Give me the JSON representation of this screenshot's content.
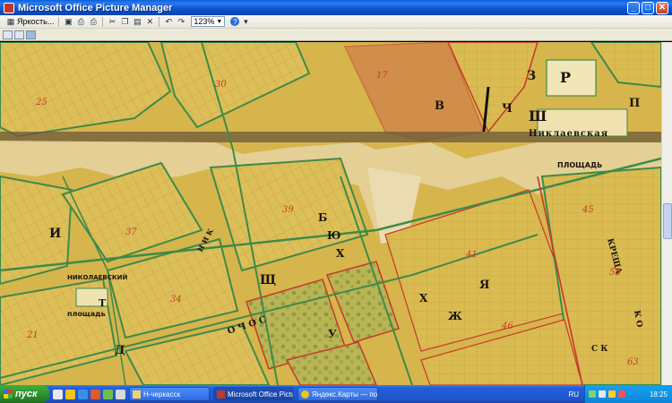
{
  "window": {
    "title": "Microsoft Office Picture Manager",
    "minimize_glyph": "_",
    "maximize_glyph": "□",
    "close_glyph": "✕"
  },
  "toolbar": {
    "edit_pictures_label": "Яркость...",
    "zoom_value": "123%",
    "help_glyph": "?"
  },
  "map": {
    "labels": {
      "nikolaevskaya": "Никлаевская",
      "ploshchad_left": "площадь",
      "ploshchad_right": "ПЛОЩАДЬ",
      "nikolaevsky": "НИКОЛАЕВСКИЙ",
      "letter_z": "З",
      "letter_r": "Р",
      "letter_v": "В",
      "letter_ch": "Ч",
      "letter_sh": "Ш",
      "letter_b": "Б",
      "letter_yu": "Ю",
      "letter_kh": "Х",
      "letter_shch": "Щ",
      "letter_i": "И",
      "letter_ya": "Я",
      "letter_kh2": "Х",
      "letter_zh": "Ж",
      "letter_t": "Т",
      "letter_d": "Д",
      "letter_o": "О",
      "letter_e": "Е",
      "letter_s": "С",
      "letter_u": "У",
      "letter_p": "П",
      "street_left": "Н И К",
      "street_right": "КРЕЩА",
      "street_diag": "О Ч О С",
      "street_bottom": "С К",
      "street_right2": "К О",
      "numbers": [
        "25",
        "30",
        "37",
        "39",
        "34",
        "41",
        "46",
        "58",
        "63",
        "21",
        "17",
        "45"
      ]
    }
  },
  "taskbar": {
    "start_label": "пуск",
    "tasks": [
      {
        "label": "Н-черкасск"
      },
      {
        "label": "Microsoft Office Pictu..."
      },
      {
        "label": "Яндекс.Карты — по..."
      }
    ],
    "language": "RU",
    "clock": "18:25"
  },
  "colors": {
    "title_blue": "#0a54d0",
    "taskbar_blue": "#245edb",
    "start_green": "#2d8d2d",
    "map_paper": "#d7b94e",
    "map_green_line": "#3e8a4a",
    "map_red_line": "#c8392b"
  }
}
